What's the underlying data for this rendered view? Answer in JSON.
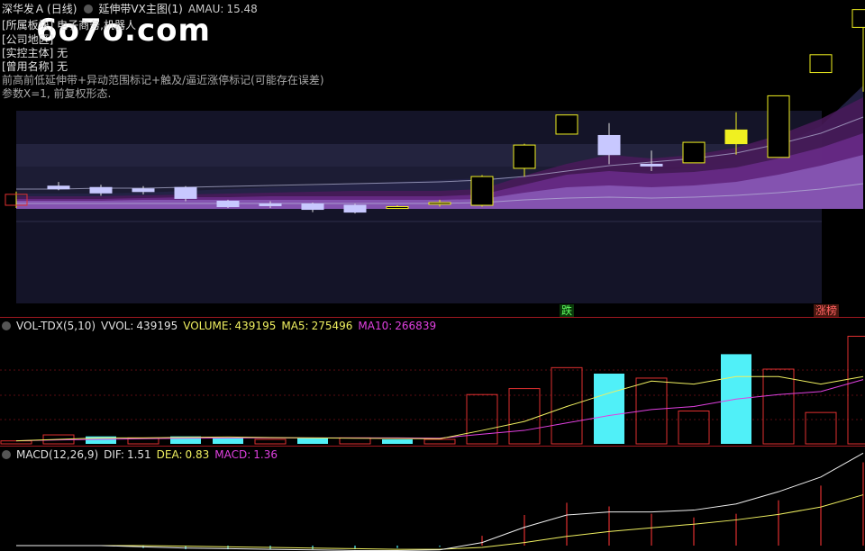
{
  "main": {
    "stock_name": "深华发Ａ",
    "period": "(日线)",
    "indicator_name": "延伸带VX主图(1)",
    "amau_label": "AMAU:",
    "amau_value": "15.48",
    "info_lines": [
      "[所属板块] 电子商务,机器人",
      "[公司地区]",
      "[实控主体] 无",
      "[曾用名称] 无",
      "前高前低延伸带+异动范围标记+触及/逼近涨停标记(可能存在误差)",
      "参数X=1, 前复权形态."
    ],
    "badge_fall": "跌",
    "badge_limit": "涨榜",
    "watermark": "6o7o.com"
  },
  "vol": {
    "name": "VOL-TDX(5,10)",
    "vvol_label": "VVOL:",
    "vvol_value": "439195",
    "volume_label": "VOLUME:",
    "volume_value": "439195",
    "ma5_label": "MA5:",
    "ma5_value": "275496",
    "ma10_label": "MA10:",
    "ma10_value": "266839"
  },
  "macd": {
    "name": "MACD(12,26,9)",
    "dif_label": "DIF:",
    "dif_value": "1.51",
    "dea_label": "DEA:",
    "dea_value": "0.83",
    "macd_label": "MACD:",
    "macd_value": "1.36"
  },
  "colors": {
    "up": "#f0f020",
    "down": "#c8c8ff",
    "vol_up": "#e03030",
    "vol_down": "#50f0f8",
    "ma5": "#f0f060",
    "ma10": "#e040e0",
    "divider": "#a01820"
  },
  "candles": [
    {
      "o": 9.5,
      "c": 10.3,
      "h": 10.5,
      "l": 9.3
    },
    {
      "o": 10.9,
      "c": 10.7,
      "h": 11.2,
      "l": 10.6
    },
    {
      "o": 10.8,
      "c": 10.4,
      "h": 11.0,
      "l": 10.2
    },
    {
      "o": 10.7,
      "c": 10.5,
      "h": 10.9,
      "l": 10.3
    },
    {
      "o": 10.8,
      "c": 10.0,
      "h": 10.9,
      "l": 9.8
    },
    {
      "o": 9.8,
      "c": 9.4,
      "h": 9.9,
      "l": 9.3
    },
    {
      "o": 9.6,
      "c": 9.5,
      "h": 9.8,
      "l": 9.3
    },
    {
      "o": 9.6,
      "c": 9.2,
      "h": 9.7,
      "l": 9.0
    },
    {
      "o": 9.5,
      "c": 9.0,
      "h": 9.6,
      "l": 8.9
    },
    {
      "o": 9.4,
      "c": 9.4,
      "h": 9.5,
      "l": 9.3
    },
    {
      "o": 9.6,
      "c": 9.7,
      "h": 9.9,
      "l": 9.4
    },
    {
      "o": 9.5,
      "c": 11.6,
      "h": 11.7,
      "l": 9.4
    },
    {
      "o": 12.2,
      "c": 13.9,
      "h": 14.0,
      "l": 11.6
    },
    {
      "o": 14.7,
      "c": 16.1,
      "h": 16.1,
      "l": 14.7
    },
    {
      "o": 14.6,
      "c": 13.2,
      "h": 15.5,
      "l": 12.5
    },
    {
      "o": 12.5,
      "c": 12.4,
      "h": 13.5,
      "l": 12.0
    },
    {
      "o": 12.6,
      "c": 14.1,
      "h": 14.1,
      "l": 12.6
    },
    {
      "o": 14.0,
      "c": 15.0,
      "h": 16.3,
      "l": 13.2
    },
    {
      "o": 13.0,
      "c": 17.5,
      "h": 17.5,
      "l": 13.0
    },
    {
      "o": 19.2,
      "c": 20.5,
      "h": 20.5,
      "l": 19.2
    },
    {
      "o": 22.5,
      "c": 23.8,
      "h": 23.8,
      "l": 17.8
    }
  ],
  "volume": [
    2,
    6,
    5,
    4,
    5,
    4,
    3,
    4,
    4,
    3,
    3,
    33,
    37,
    51,
    47,
    44,
    22,
    60,
    50,
    21,
    72
  ],
  "ma5": [
    2,
    3,
    4,
    4,
    4.4,
    4.6,
    4.2,
    4.0,
    3.8,
    3.6,
    3.4,
    9,
    15,
    25,
    34,
    42,
    40,
    45,
    45,
    40,
    45
  ],
  "ma10": [
    2,
    2.6,
    3,
    3.5,
    3.8,
    4,
    4,
    4,
    4,
    4,
    3.8,
    6.5,
    9,
    14,
    19,
    23,
    25,
    30,
    33,
    35,
    43
  ],
  "dif": [
    0.0,
    0.0,
    0.0,
    -0.02,
    -0.04,
    -0.05,
    -0.06,
    -0.07,
    -0.08,
    -0.08,
    -0.07,
    0.05,
    0.3,
    0.5,
    0.55,
    0.55,
    0.58,
    0.68,
    0.88,
    1.12,
    1.51
  ],
  "dea": [
    0.0,
    0.0,
    0.0,
    0.0,
    -0.01,
    -0.02,
    -0.03,
    -0.04,
    -0.05,
    -0.06,
    -0.06,
    -0.03,
    0.05,
    0.15,
    0.23,
    0.29,
    0.35,
    0.42,
    0.51,
    0.63,
    0.83
  ],
  "macd_hist": [
    0.0,
    0.0,
    0.0,
    -0.04,
    -0.06,
    -0.06,
    -0.06,
    -0.06,
    -0.06,
    -0.04,
    -0.02,
    0.16,
    0.5,
    0.7,
    0.64,
    0.52,
    0.46,
    0.52,
    0.74,
    0.98,
    1.36
  ]
}
